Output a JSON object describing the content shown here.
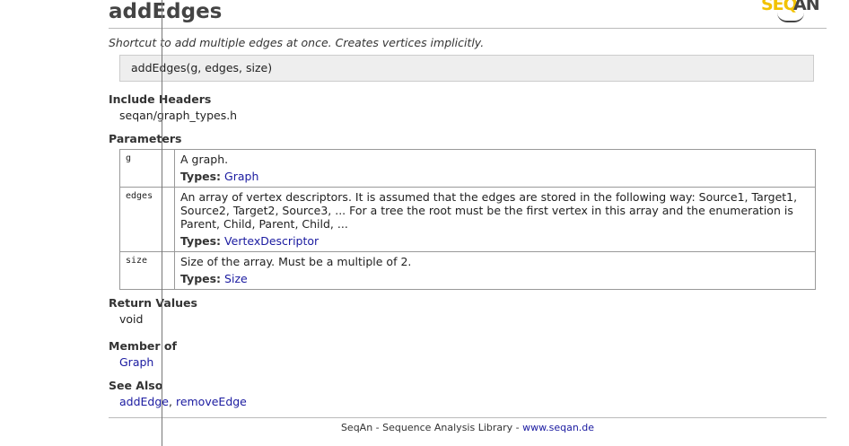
{
  "title": "addEdges",
  "logo": {
    "part1": "SEQ",
    "part2": "AN"
  },
  "description": "Shortcut to add multiple edges at once. Creates vertices implicitly.",
  "signature": "addEdges(g, edges, size)",
  "include_headers": {
    "heading": "Include Headers",
    "value": "seqan/graph_types.h"
  },
  "parameters": {
    "heading": "Parameters",
    "types_label": "Types:",
    "rows": [
      {
        "name": "g",
        "desc": "A graph.",
        "type": "Graph"
      },
      {
        "name": "edges",
        "desc": "An array of vertex descriptors. It is assumed that the edges are stored in the following way: Source1, Target1, Source2, Target2, Source3, ... For a tree the root must be the first vertex in this array and the enumeration is Parent, Child, Parent, Child, ...",
        "type": "VertexDescriptor"
      },
      {
        "name": "size",
        "desc": "Size of the array. Must be a multiple of 2.",
        "type": "Size"
      }
    ]
  },
  "return_values": {
    "heading": "Return Values",
    "value": "void"
  },
  "member_of": {
    "heading": "Member of",
    "value": "Graph"
  },
  "see_also": {
    "heading": "See Also",
    "links": [
      "addEdge",
      "removeEdge"
    ],
    "separator": ", "
  },
  "footer": {
    "text": "SeqAn - Sequence Analysis Library - ",
    "link": "www.seqan.de"
  }
}
